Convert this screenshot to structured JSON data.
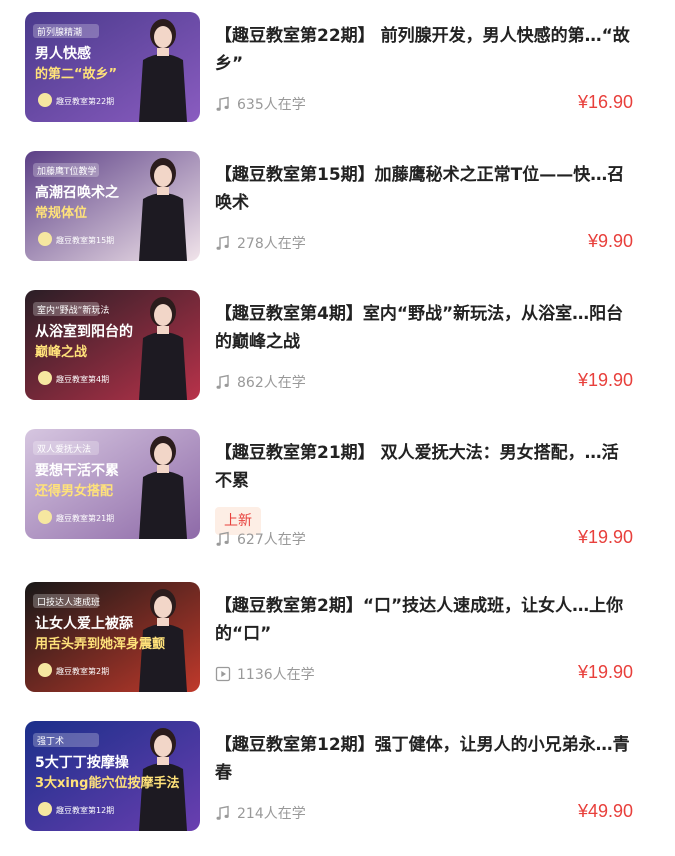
{
  "courses": [
    {
      "title": "【趣豆教室第22期】 前列腺开发，男人快感的第…“故乡”",
      "learners": "635人在学",
      "media_icon": "music-note-icon",
      "price": "¥16.90",
      "thumb": {
        "badge": "前列腺精潮",
        "line1": "男人快感",
        "line2": "的第二“故乡”",
        "footer": "趣豆教室第22期",
        "bg1": "#4a3a8c",
        "bg2": "#8a5cc0"
      }
    },
    {
      "title": "【趣豆教室第15期】加藤鹰秘术之正常T位——快…召唤术",
      "learners": "278人在学",
      "media_icon": "music-note-icon",
      "price": "¥9.90",
      "thumb": {
        "badge": "加藤鹰T位教学",
        "line1": "高潮召唤术之",
        "line2": "常规体位",
        "footer": "趣豆教室第15期",
        "bg1": "#5b3f86",
        "bg2": "#f1e4ea"
      }
    },
    {
      "title": "【趣豆教室第4期】室内“野战”新玩法，从浴室…阳台的巅峰之战",
      "learners": "862人在学",
      "media_icon": "music-note-icon",
      "price": "¥19.90",
      "thumb": {
        "badge": "室内“野战”新玩法",
        "line1": "从浴室到阳台的",
        "line2": "巅峰之战",
        "footer": "趣豆教室第4期",
        "bg1": "#2a1e26",
        "bg2": "#b8324a"
      }
    },
    {
      "title": "【趣豆教室第21期】 双人爱抚大法：男女搭配，…活不累",
      "tag": "上新",
      "learners": "627人在学",
      "media_icon": "music-note-icon",
      "price": "¥19.90",
      "thumb": {
        "badge": "双人爱抚大法",
        "line1": "要想干活不累",
        "line2": "还得男女搭配",
        "footer": "趣豆教室第21期",
        "bg1": "#d6c6e0",
        "bg2": "#8e6aa8"
      }
    },
    {
      "title": "【趣豆教室第2期】“口”技达人速成班，让女人…上你的“口”",
      "learners": "1136人在学",
      "media_icon": "play-video-icon",
      "price": "¥19.90",
      "thumb": {
        "badge": "口技达人速成班",
        "line1": "让女人爱上被舔",
        "line2": "用舌头弄到她浑身震颤",
        "footer": "趣豆教室第2期",
        "bg1": "#181818",
        "bg2": "#c0392b"
      }
    },
    {
      "title": "【趣豆教室第12期】强丁健体，让男人的小兄弟永…青春",
      "learners": "214人在学",
      "media_icon": "music-note-icon",
      "price": "¥49.90",
      "thumb": {
        "badge": "强丁术",
        "line1": "5大丁丁按摩操",
        "line2": "3大xing能穴位按摩手法",
        "footer": "趣豆教室第12期",
        "bg1": "#1b2f8a",
        "bg2": "#6a3fb0"
      }
    }
  ]
}
